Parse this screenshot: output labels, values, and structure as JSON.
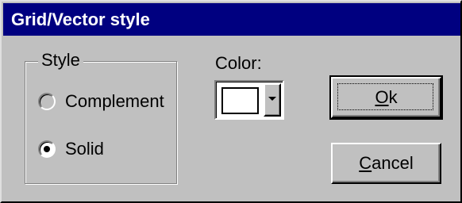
{
  "window": {
    "title": "Grid/Vector style"
  },
  "style_group": {
    "label": "Style",
    "options": [
      {
        "label": "Complement",
        "selected": false
      },
      {
        "label": "Solid",
        "selected": true
      }
    ]
  },
  "color": {
    "label": "Color:",
    "value": "#ffffff"
  },
  "buttons": {
    "ok": {
      "mnemonic": "O",
      "rest": "k"
    },
    "cancel": {
      "mnemonic": "C",
      "rest": "ancel"
    }
  }
}
